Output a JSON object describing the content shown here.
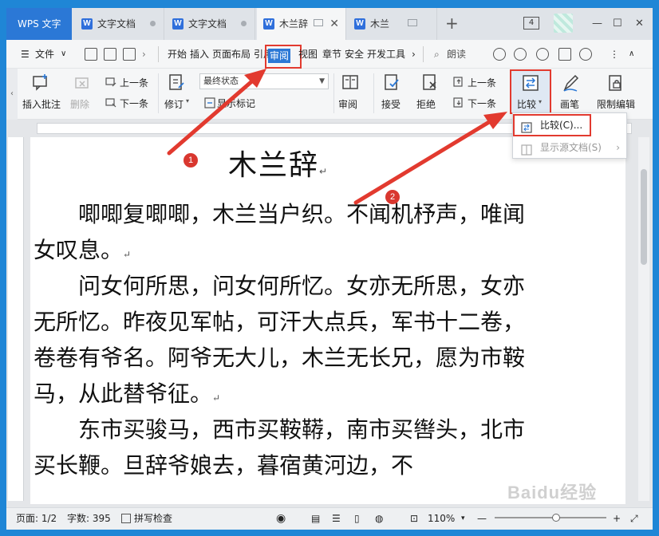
{
  "titlebar": {
    "app_tab": "WPS 文字",
    "tabs": [
      {
        "label": "文字文档"
      },
      {
        "label": "文字文档"
      },
      {
        "label": "木兰辞"
      },
      {
        "label": "木兰"
      }
    ],
    "tab_icon": "W",
    "new_tab": "+",
    "tab_count": "4",
    "win_min": "—",
    "win_max": "☐",
    "win_close": "✕"
  },
  "menubar": {
    "file": "文件",
    "items": [
      "开始",
      "插入",
      "页面布局",
      "引用",
      "审阅",
      "视图",
      "章节",
      "安全",
      "开发工具"
    ],
    "more": "›",
    "read_aloud": "朗读"
  },
  "ribbon": {
    "insert_comment": "插入批注",
    "delete": "删除",
    "prev_comment": "上一条",
    "next_comment": "下一条",
    "revision": "修订",
    "final_state": "最终状态",
    "show_markup": "显示标记",
    "review": "审阅",
    "accept": "接受",
    "reject": "拒绝",
    "prev_change": "上一条",
    "next_change": "下一条",
    "compare": "比较",
    "pen": "画笔",
    "restrict_edit": "限制编辑"
  },
  "dropdown": {
    "compare_item": "比较(C)...",
    "show_source": "显示源文档(S)"
  },
  "document": {
    "title": "木兰辞",
    "paragraphs": [
      "唧唧复唧唧，木兰当户织。不闻机杼声，唯闻女叹息。",
      "问女何所思，问女何所忆。女亦无所思，女亦无所忆。昨夜见军帖，可汗大点兵，军书十二卷，卷卷有爷名。阿爷无大儿，木兰无长兄，愿为市鞍马，从此替爷征。",
      "东市买骏马，西市买鞍鞯，南市买辔头，北市买长鞭。旦辞爷娘去，暮宿黄河边，不"
    ],
    "para_mark": "↵"
  },
  "annotations": {
    "marker1": "1",
    "marker2": "2"
  },
  "statusbar": {
    "page": "页面: 1/2",
    "words": "字数: 395",
    "spellcheck": "拼写检查",
    "zoom": "110%",
    "zoom_level_percent": 55
  },
  "watermark": "Baidu经验",
  "colors": {
    "accent": "#2b78d6",
    "highlight_red": "#e23a2f",
    "marker_red": "#d9372f"
  }
}
